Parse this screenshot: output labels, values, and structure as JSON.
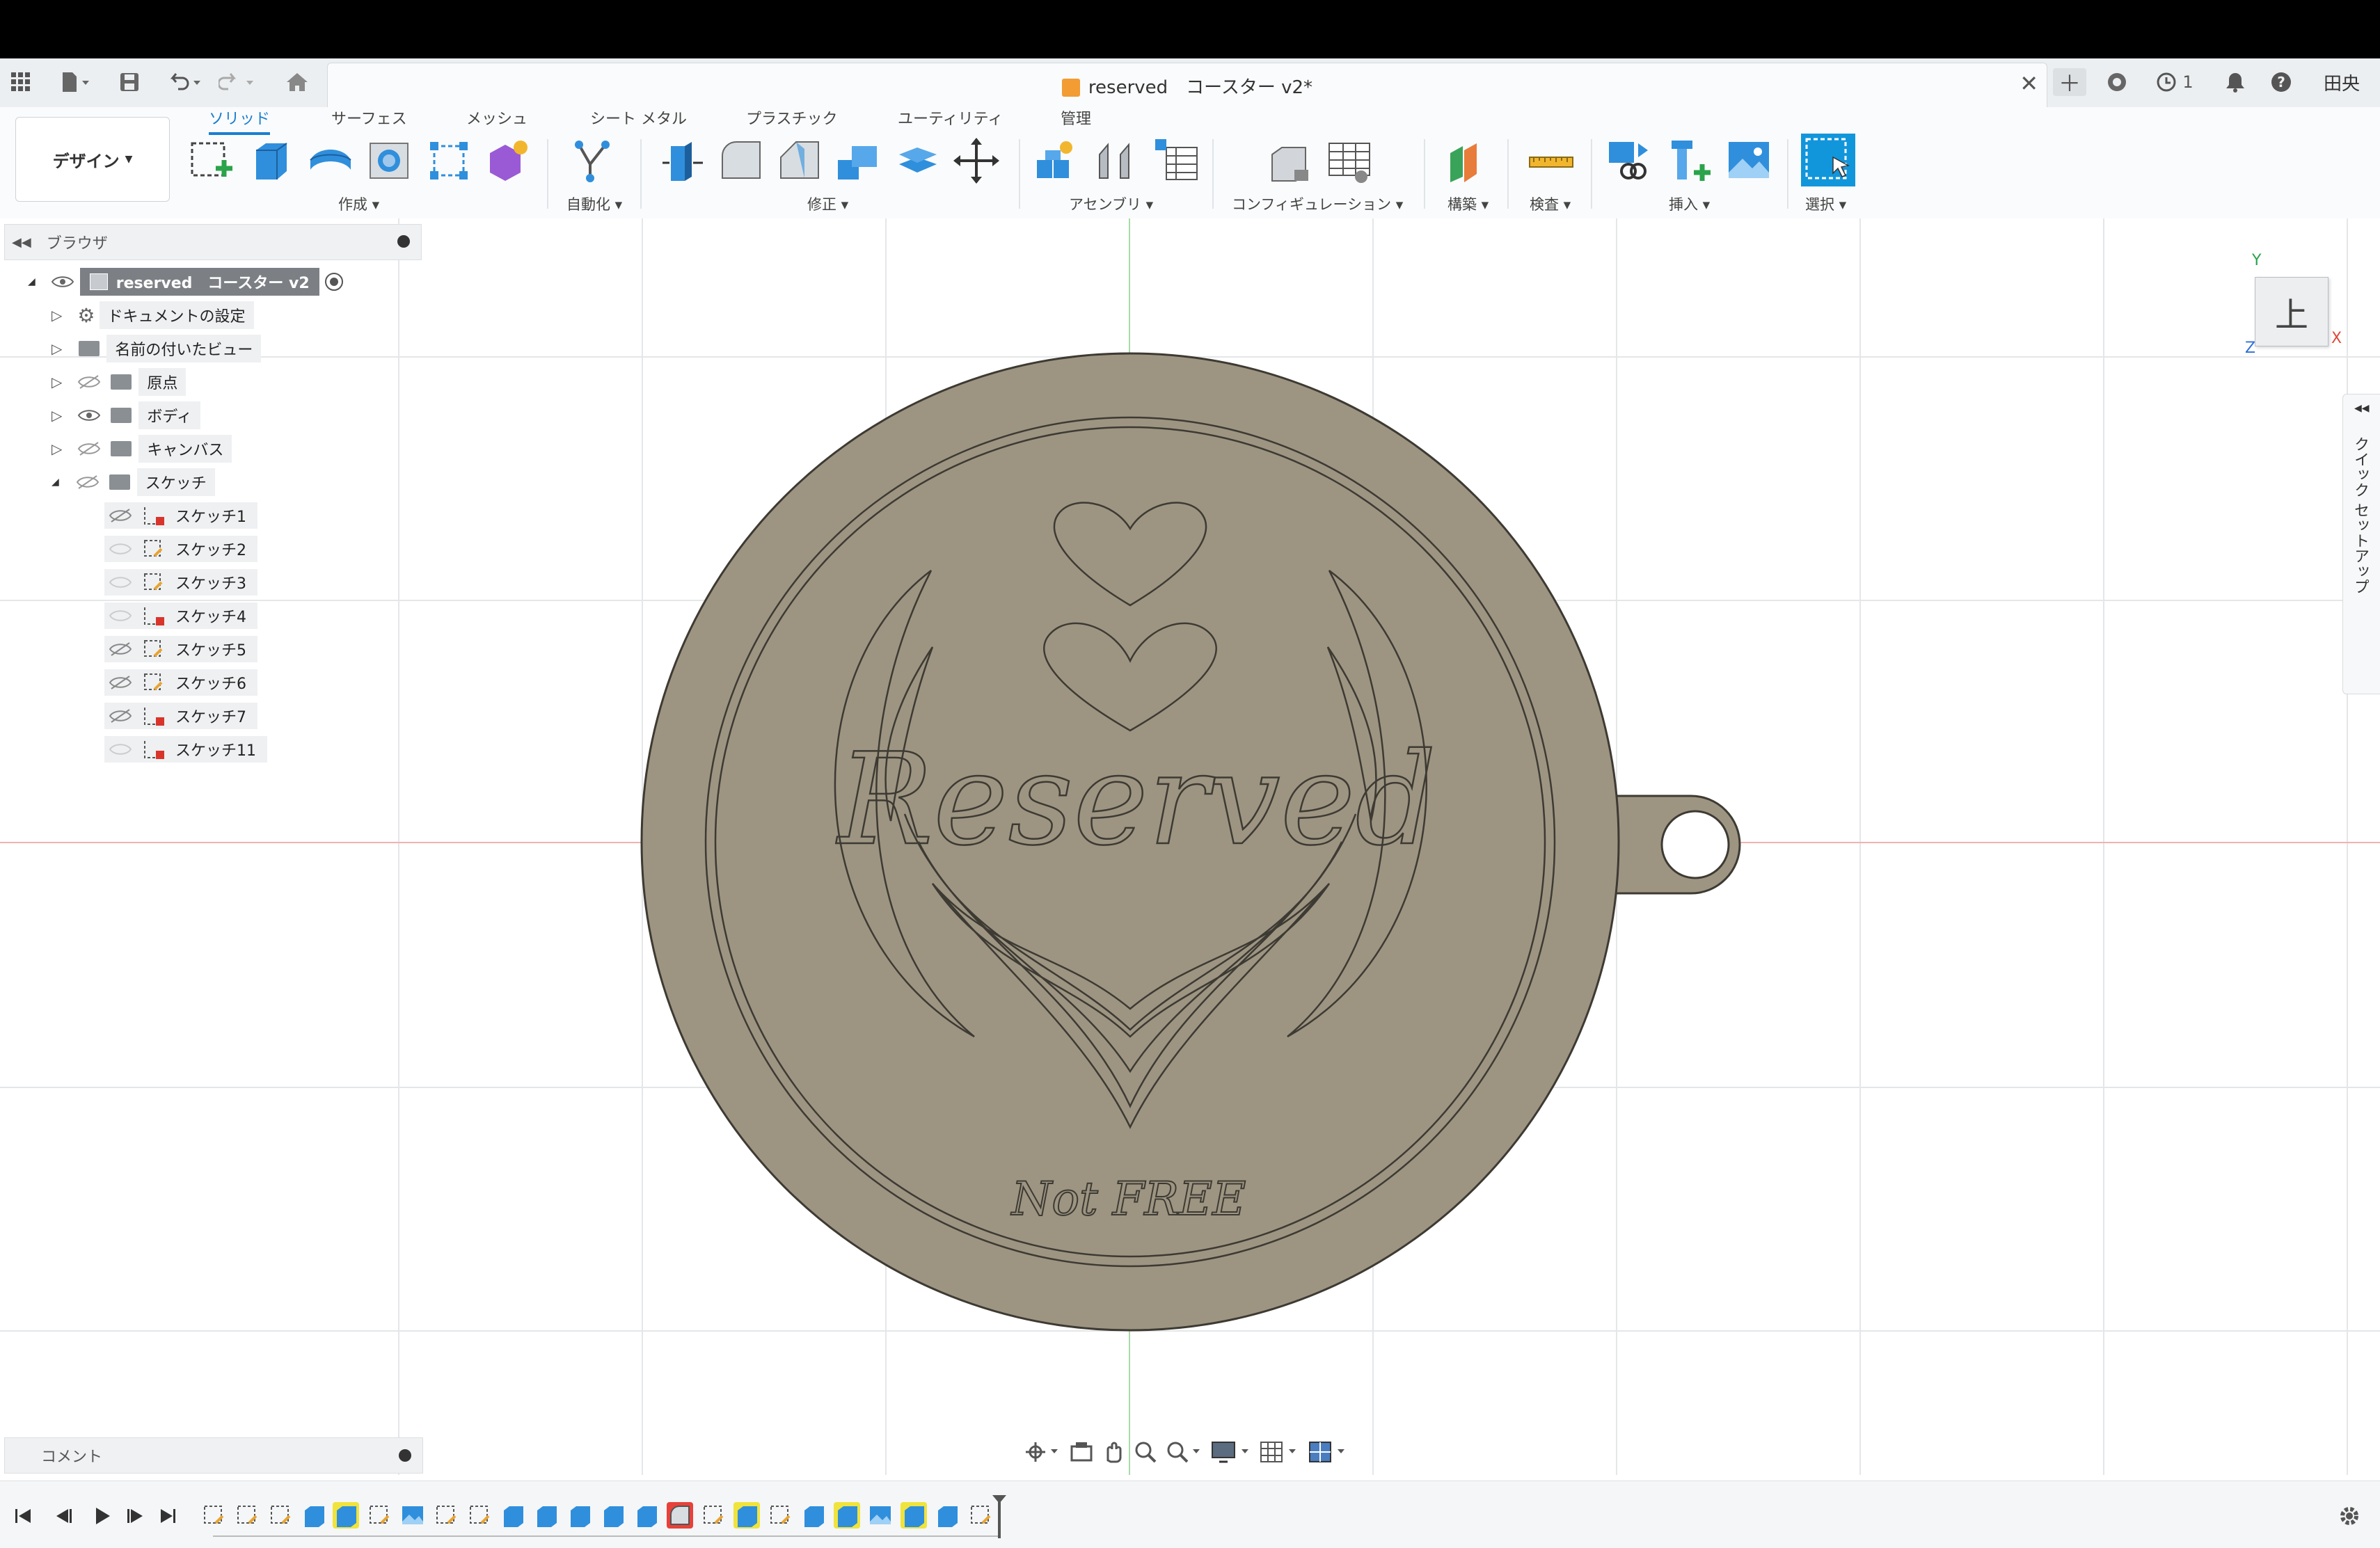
{
  "window": {
    "title": "reserved　コースター v2*",
    "user": "田央",
    "job_count": "1"
  },
  "ribbon": {
    "workspace": "デザイン",
    "tabs": [
      "ソリッド",
      "サーフェス",
      "メッシュ",
      "シート メタル",
      "プラスチック",
      "ユーティリティ",
      "管理"
    ],
    "active_tab": "ソリッド",
    "groups": {
      "create": "作成",
      "automate": "自動化",
      "modify": "修正",
      "assemble": "アセンブリ",
      "configure": "コンフィギュレーション",
      "construct": "構築",
      "inspect": "検査",
      "insert": "挿入",
      "select": "選択"
    }
  },
  "browser": {
    "title": "ブラウザ",
    "root": "reserved　コースター v2",
    "items": [
      {
        "label": "ドキュメントの設定",
        "icon": "gear-icon"
      },
      {
        "label": "名前の付いたビュー",
        "icon": "folder-icon"
      },
      {
        "label": "原点",
        "icon": "folder-icon"
      },
      {
        "label": "ボディ",
        "icon": "folder-icon"
      },
      {
        "label": "キャンバス",
        "icon": "folder-icon"
      },
      {
        "label": "スケッチ",
        "icon": "folder-icon"
      }
    ],
    "sketches": [
      "スケッチ1",
      "スケッチ2",
      "スケッチ3",
      "スケッチ4",
      "スケッチ5",
      "スケッチ6",
      "スケッチ7",
      "スケッチ11"
    ]
  },
  "comments": {
    "title": "コメント"
  },
  "quick_setup": {
    "label": "クイック セットアップ"
  },
  "viewcube": {
    "face": "上",
    "axes": {
      "x": "X",
      "y": "Y",
      "z": "Z"
    }
  },
  "model": {
    "text_main": "Reserved",
    "text_sub": "Not FREE"
  },
  "colors": {
    "accent": "#1a7fd0",
    "model_fill": "#9d9582",
    "model_edge": "#3d3a33",
    "select_blue": "#1296db",
    "timeline_highlight": "#f0e33c",
    "timeline_red": "#e8413a"
  }
}
